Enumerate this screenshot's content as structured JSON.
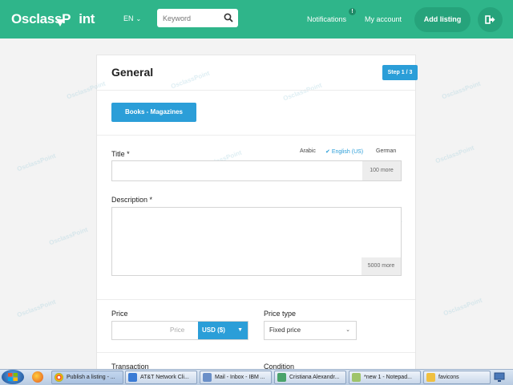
{
  "header": {
    "logo": "OsclassP",
    "logo_tail": "int",
    "language": "EN",
    "search_placeholder": "Keyword",
    "notifications_label": "Notifications",
    "notifications_badge": "!",
    "account_label": "My account",
    "add_listing_label": "Add listing"
  },
  "form": {
    "section_title": "General",
    "step_label": "Step 1 / 3",
    "category_label": "Books - Magazines",
    "title_label": "Title *",
    "languages": [
      "Arabic",
      "English (US)",
      "German"
    ],
    "active_language": "English (US)",
    "title_counter": "100 more",
    "description_label": "Description *",
    "description_counter": "5000 more",
    "price_label": "Price",
    "price_placeholder": "Price",
    "currency": "USD ($)",
    "price_type_label": "Price type",
    "price_type_value": "Fixed price",
    "transaction_label": "Transaction",
    "condition_label": "Condition"
  },
  "watermark_text": "OsclassPoint",
  "taskbar": {
    "tasks": [
      {
        "label": "Publish a listing - ...",
        "active": true
      },
      {
        "label": "AT&T Network Cli...",
        "active": false
      },
      {
        "label": "Mail - Inbox - IBM ...",
        "active": false
      },
      {
        "label": "Cristiana Alexandr...",
        "active": false
      },
      {
        "label": "*new 1 - Notepad...",
        "active": false
      },
      {
        "label": "favicons",
        "active": false
      }
    ]
  },
  "colors": {
    "brand": "#2fb58a",
    "accent_blue": "#2b9ed8"
  }
}
